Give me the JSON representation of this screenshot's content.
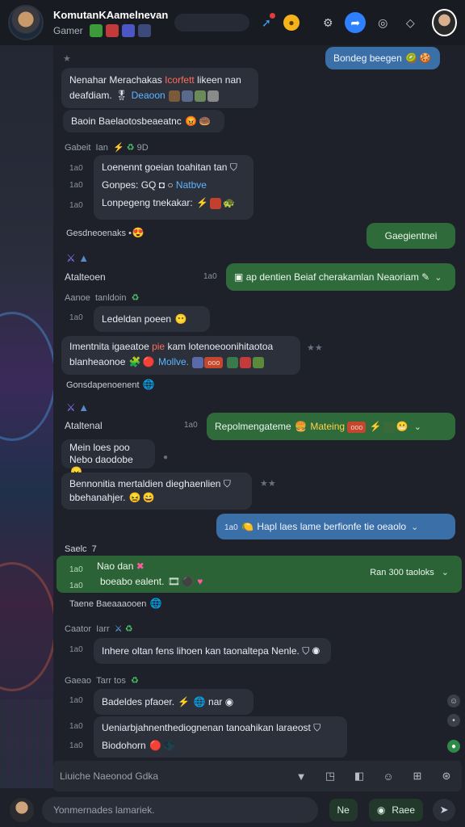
{
  "header": {
    "group_title": "KomutanKAamelnevan",
    "group_role": "Gamer",
    "badge_colors": [
      "#3c9a3a",
      "#c23a3a",
      "#4a57c4",
      "#3b4a7a"
    ]
  },
  "messages": {
    "m1_text": "Bondeg beegen",
    "m2_line1_a": "Nenahar Merachakas",
    "m2_line1_tag": "Icorfett",
    "m2_line1_b": "likeen nan",
    "m2_line2_a": "deafdiam.",
    "m2_line2_tag": "Deaoon",
    "m3_text": "Baoin Baelaotosbeaeatnc",
    "m4_name": "Gabeit",
    "m4_sub": "Ian",
    "m4_count": "9D",
    "m4_l1": "Loenennt goeian toahitan tan",
    "m4_l2_a": "Gonpes:",
    "m4_l2_b": "GQ",
    "m4_l2_tag": "Natbve",
    "m4_l3": "Lonpegeng tnekakar:",
    "m4_t1": "1a0",
    "m4_t2": "1a0",
    "m4_t3": "1a0",
    "m5_text": "Gesdneoenaks",
    "m6_text": "Gaegientnei",
    "m7_name": "Atalteoen",
    "m7_time": "1a0",
    "m7_text": "ap dentien Beiaf cherakamlan Neaoriam",
    "m8_name": "Aanoe",
    "m8_sub": "tanldoin",
    "m8_time": "1a0",
    "m8_text": "Ledeldan poeen",
    "m9_l1_a": "Imentnita igaeatoe",
    "m9_l1_tag": "pie",
    "m9_l1_b": "kam lotenoeoonihitaotoa",
    "m9_l2_a": "blanheaonoe",
    "m9_l2_tag": "Mollve.",
    "m10_text": "Gonsdapenoenent",
    "m11_name": "Ataltenal",
    "m11_time": "1a0",
    "m11_text": "Repolmengateme",
    "m11_tag": "Mateing",
    "m11_chip": "ooo",
    "m12_l1": "Mein loes poo",
    "m12_l2": "Nebo daodobe",
    "m13_l1": "Bennonitia mertaldien dieghaenlien",
    "m13_l2": "bbehanahjer.",
    "m14_time": "1a0",
    "m14_text": "Hapl laes lame berfionfe tie oeaolo",
    "m15_name": "Saelc",
    "m15_count": "7",
    "m15_t1": "1a0",
    "m15_t2": "1a0",
    "m15_l1": "Nao dan",
    "m15_l2": "boeabo ealent.",
    "m15_right": "Ran 300 taoloks",
    "m16_text": "Taene Baeaaaooen",
    "m17_name": "Caator",
    "m17_sub": "Iarr",
    "m17_time": "1a0",
    "m17_text": "Inhere oltan fens lihoen kan taonaltepa Nenle.",
    "m18_name": "Gaeao",
    "m18_sub": "Tarr tos",
    "m18_t1": "1a0",
    "m18_t2": "1a0",
    "m18_t3": "1a0",
    "m18_l1": "Badeldes pfaoer.",
    "m18_l1_b": "nar",
    "m18_l2": "Ueniarbjahnenthediognenan tanoahikan laraeost",
    "m18_l3": "Biodohorn"
  },
  "input": {
    "placeholder": "Liuiche Naeonod Gdka",
    "compose_placeholder": "Yonmernades lamariek.",
    "pill_1": "Ne",
    "pill_2": "Raee"
  }
}
